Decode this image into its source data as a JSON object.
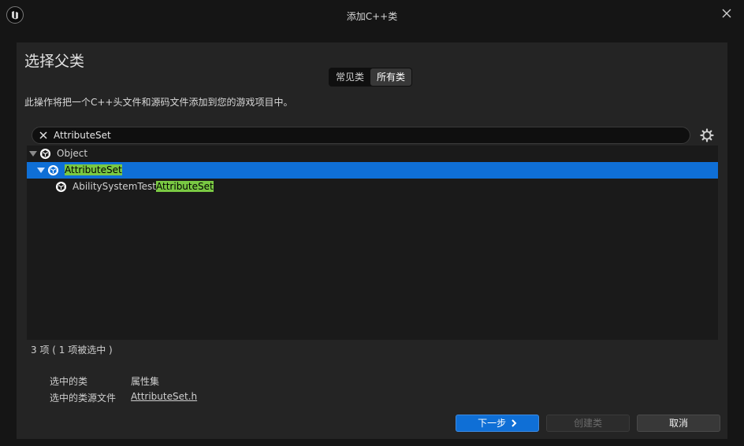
{
  "window": {
    "title": "添加C++类"
  },
  "page": {
    "heading": "选择父类",
    "tabs": [
      {
        "label": "常见类",
        "active": false
      },
      {
        "label": "所有类",
        "active": true
      }
    ],
    "description": "此操作将把一个C++头文件和源码文件添加到您的游戏项目中。"
  },
  "search": {
    "value": "AttributeSet"
  },
  "tree": {
    "rows": [
      {
        "label_pre": "",
        "label_hl": "",
        "label_post": "Object",
        "expanded": true,
        "selected": false
      },
      {
        "label_pre": "",
        "label_hl": "AttributeSet",
        "label_post": "",
        "expanded": true,
        "selected": true
      },
      {
        "label_pre": "AbilitySystemTest",
        "label_hl": "AttributeSet",
        "label_post": "",
        "expanded": false,
        "selected": false
      }
    ]
  },
  "status": {
    "count_text": "3 项 ( 1 项被选中 )"
  },
  "info": {
    "selected_class_label": "选中的类",
    "selected_class_value": "属性集",
    "source_file_label": "选中的类源文件",
    "source_file_value": "AttributeSet.h"
  },
  "buttons": {
    "next": "下一步",
    "create": "创建类",
    "cancel": "取消"
  },
  "colors": {
    "accent": "#0f6fd6",
    "highlight": "#7ac943"
  },
  "icons": [
    "unreal-logo-icon",
    "close-icon",
    "clear-search-icon",
    "settings-gear-icon",
    "class-icon",
    "expand-arrow-icon",
    "chevron-right-icon"
  ]
}
